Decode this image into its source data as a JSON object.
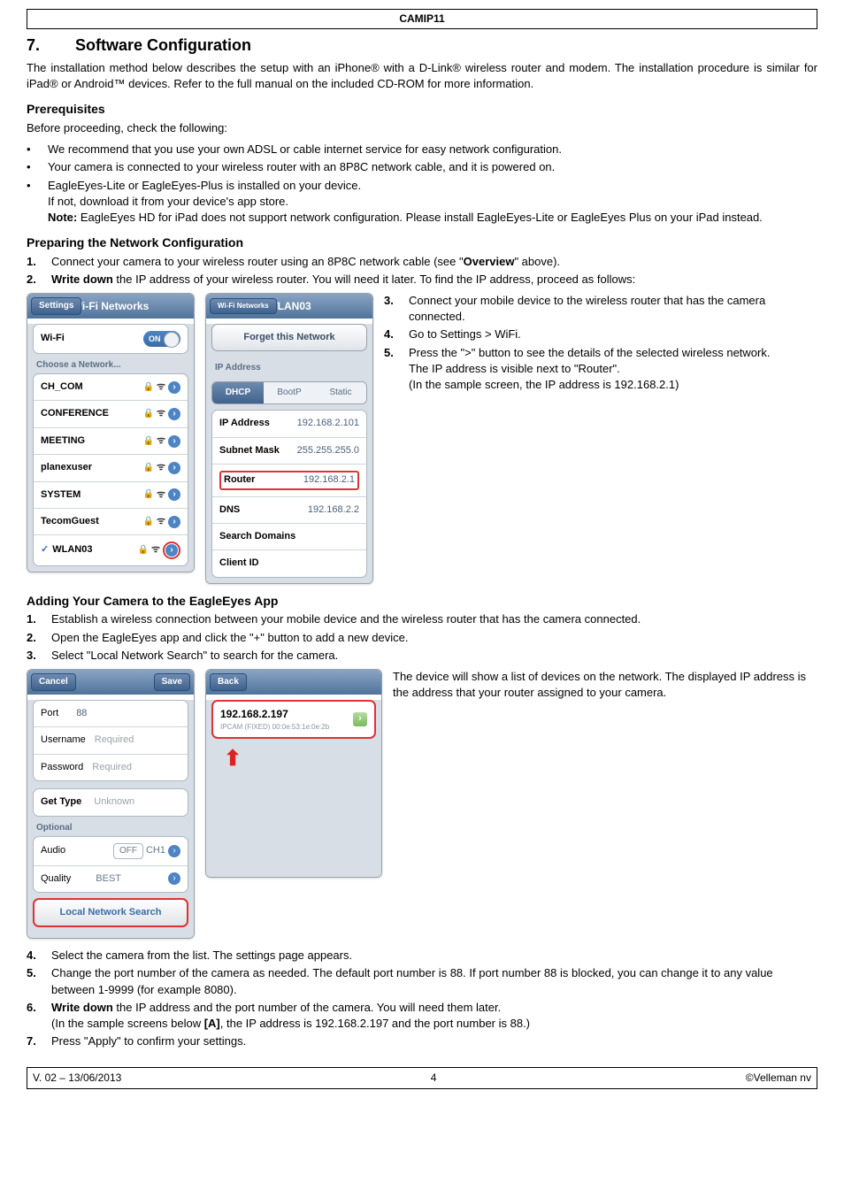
{
  "doc": {
    "product": "CAMIP11"
  },
  "section": {
    "num": "7.",
    "title": "Software Configuration"
  },
  "intro": "The installation method below describes the setup with an iPhone® with a D-Link® wireless router and modem. The installation procedure is similar for iPad® or Android™ devices. Refer to the full manual on the included CD-ROM for more information.",
  "prereq": {
    "title": "Prerequisites",
    "lead": "Before proceeding, check the following:",
    "items": [
      "We recommend that you use your own ADSL or cable internet service for easy network configuration.",
      "Your camera is connected to your wireless router with an 8P8C network cable, and it is powered on.",
      "EagleEyes-Lite or EagleEyes-Plus is installed on your device.",
      "If not, download it from your device's app store.",
      "Note: EagleEyes HD for iPad does not support network configuration. Please install EagleEyes-Lite or EagleEyes Plus on your iPad instead."
    ]
  },
  "prep": {
    "title": "Preparing the Network Configuration",
    "s1": "Connect your camera to your wireless router using an 8P8C network cable (see \"Overview\" above).",
    "s2": "Write down the IP address of your wireless router. You will need it later. To find the IP address, proceed as follows:",
    "s3": "Connect your mobile device to the wireless router that has the camera connected.",
    "s4": "Go to Settings > WiFi.",
    "s5": "Press the \">\" button to see the details of the selected wireless network.",
    "s5b": "The IP address is visible next to \"Router\".",
    "s5c": "(In the sample screen, the IP address is 192.168.2.1)"
  },
  "wifiPanel": {
    "nav_back": "Settings",
    "nav_title": "Wi-Fi Networks",
    "row_wifi": "Wi-Fi",
    "switch": "ON",
    "group": "Choose a Network...",
    "nets": [
      "CH_COM",
      "CONFERENCE",
      "MEETING",
      "planexuser",
      "SYSTEM",
      "TecomGuest",
      "WLAN03"
    ]
  },
  "detailPanel": {
    "nav_back": "Wi-Fi Networks",
    "nav_title": "WLAN03",
    "forget": "Forget this Network",
    "group": "IP Address",
    "seg": [
      "DHCP",
      "BootP",
      "Static"
    ],
    "rows": {
      "ip_l": "IP Address",
      "ip_v": "192.168.2.101",
      "mask_l": "Subnet Mask",
      "mask_v": "255.255.255.0",
      "router_l": "Router",
      "router_v": "192.168.2.1",
      "dns_l": "DNS",
      "dns_v": "192.168.2.2",
      "sd_l": "Search Domains",
      "cid_l": "Client ID"
    }
  },
  "adding": {
    "title": "Adding Your Camera to the EagleEyes App",
    "s1": "Establish a wireless connection between your mobile device and the wireless router that has the camera connected.",
    "s2": "Open the EagleEyes app and click the \"+\" button to add a new device.",
    "s3": "Select \"Local Network Search\" to search for the camera.",
    "sideText": "The device will show a list of devices on the network. The displayed IP address is the address that your router assigned to your camera.",
    "s4": "Select the camera from the list. The settings page appears.",
    "s5": "Change the port number of the camera as needed. The default port number is 88. If port number 88 is blocked, you can change it to any value between 1-9999 (for example 8080).",
    "s6a": "Write down the IP address and the port number of the camera. You will need them later.",
    "s6b": "(In the sample screens below [A], the IP address is 192.168.2.197 and the port number is 88.)",
    "s7": "Press \"Apply\" to confirm your settings."
  },
  "devForm": {
    "cancel": "Cancel",
    "save": "Save",
    "port_l": "Port",
    "port_v": "88",
    "user_l": "Username",
    "user_ph": "Required",
    "pass_l": "Password",
    "pass_ph": "Required",
    "gettype_l": "Get Type",
    "gettype_v": "Unknown",
    "opt": "Optional",
    "audio_l": "Audio",
    "audio_off": "OFF",
    "audio_ch": "CH1",
    "quality_l": "Quality",
    "quality_v": "BEST",
    "lns": "Local Network Search"
  },
  "resultPanel": {
    "back": "Back",
    "ip": "192.168.2.197",
    "sub": "IPCAM (FIXED)   00:0e:53:1e:0e:2b"
  },
  "footer": {
    "left": "V. 02 – 13/06/2013",
    "center": "4",
    "right": "©Velleman nv"
  }
}
